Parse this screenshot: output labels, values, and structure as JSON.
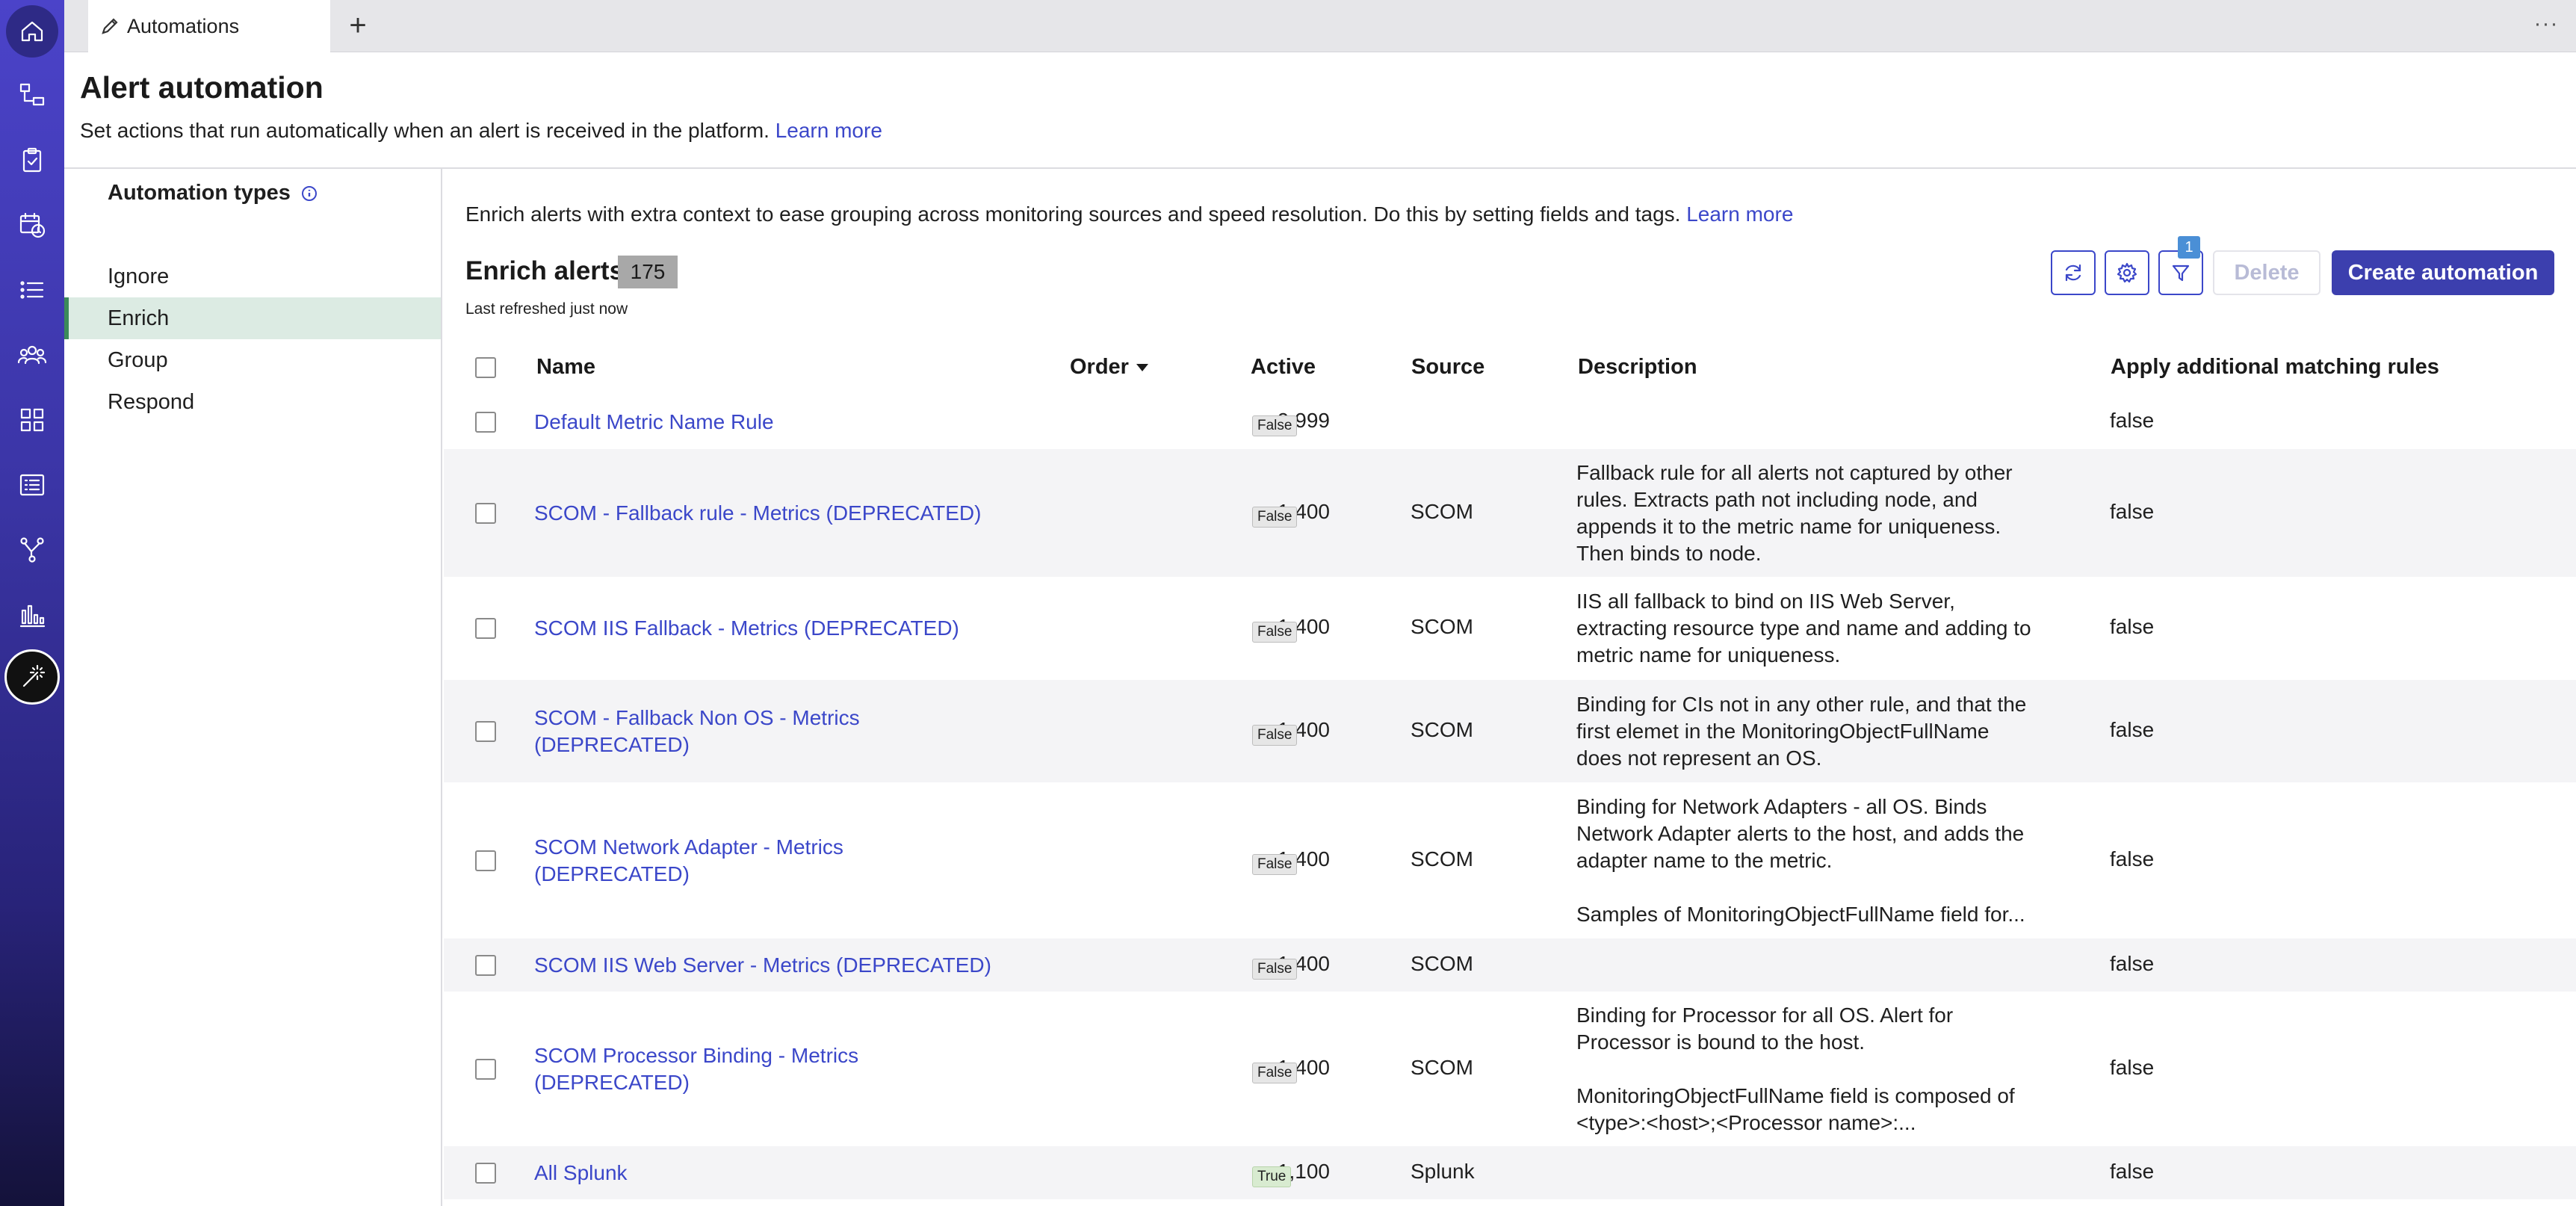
{
  "tab": {
    "label": "Automations",
    "add_label": "+",
    "more_label": "···"
  },
  "header": {
    "title": "Alert automation",
    "subtitle": "Set actions that run automatically when an alert is received in the platform.",
    "learn_more": "Learn more"
  },
  "types": {
    "heading": "Automation types",
    "items": [
      {
        "label": "Ignore",
        "active": false
      },
      {
        "label": "Enrich",
        "active": true
      },
      {
        "label": "Group",
        "active": false
      },
      {
        "label": "Respond",
        "active": false
      }
    ]
  },
  "main": {
    "intro": "Enrich alerts with extra context to ease grouping across monitoring sources and speed resolution. Do this by setting fields and tags.",
    "intro_link": "Learn more",
    "section_title": "Enrich alerts",
    "count": "175",
    "refreshed": "Last refreshed just now",
    "filter_count": "1",
    "delete_label": "Delete",
    "create_label": "Create automation"
  },
  "table": {
    "columns": {
      "name": "Name",
      "order": "Order",
      "active": "Active",
      "source": "Source",
      "description": "Description",
      "apply": "Apply additional matching rules"
    },
    "rows": [
      {
        "name": [
          "Default Metric Name Rule"
        ],
        "order": "9,999",
        "active": "False",
        "source": "",
        "description": [],
        "apply": "false"
      },
      {
        "name": [
          "SCOM - Fallback rule - Metrics (DEPRECATED)"
        ],
        "order": "1,400",
        "active": "False",
        "source": "SCOM",
        "description": [
          "Fallback rule for all alerts not captured by other",
          "rules. Extracts path not including node, and",
          "appends it to the metric name for uniqueness.",
          "Then binds to node."
        ],
        "apply": "false"
      },
      {
        "name": [
          "SCOM IIS Fallback - Metrics (DEPRECATED)"
        ],
        "order": "1,400",
        "active": "False",
        "source": "SCOM",
        "description": [
          "IIS all fallback to bind on IIS Web Server,",
          "extracting resource type and name and adding to",
          "metric name for uniqueness."
        ],
        "apply": "false"
      },
      {
        "name": [
          "SCOM - Fallback Non OS - Metrics",
          "(DEPRECATED)"
        ],
        "order": "1,400",
        "active": "False",
        "source": "SCOM",
        "description": [
          "Binding for CIs not in any other rule, and that the",
          "first elemet in the MonitoringObjectFullName",
          "does not represent an OS."
        ],
        "apply": "false"
      },
      {
        "name": [
          "SCOM Network Adapter - Metrics",
          "(DEPRECATED)"
        ],
        "order": "1,400",
        "active": "False",
        "source": "SCOM",
        "description": [
          "Binding for Network Adapters - all OS. Binds",
          "Network Adapter alerts to the host, and adds the",
          "adapter name to the metric.",
          "",
          "Samples of MonitoringObjectFullName field for..."
        ],
        "apply": "false"
      },
      {
        "name": [
          "SCOM IIS Web Server - Metrics (DEPRECATED)"
        ],
        "order": "1,400",
        "active": "False",
        "source": "SCOM",
        "description": [],
        "apply": "false"
      },
      {
        "name": [
          "SCOM Processor Binding - Metrics",
          "(DEPRECATED)"
        ],
        "order": "1,400",
        "active": "False",
        "source": "SCOM",
        "description": [
          "Binding for Processor for all OS. Alert for",
          "Processor is bound to the host.",
          "",
          "MonitoringObjectFullName field is composed of",
          "<type>:<host>;<Processor name>:..."
        ],
        "apply": "false"
      },
      {
        "name": [
          "All Splunk"
        ],
        "order": "1,100",
        "active": "True",
        "source": "Splunk",
        "description": [],
        "apply": "false"
      }
    ]
  }
}
